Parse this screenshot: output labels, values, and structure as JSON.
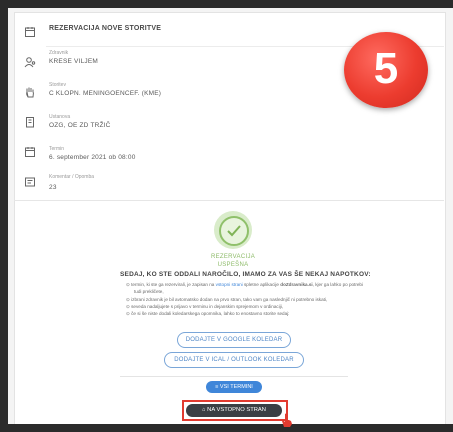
{
  "header": {
    "title": "REZERVACIJA NOVE STORITVE"
  },
  "fields": [
    {
      "label": "Zdravnik",
      "value": "KRESE VILJEM",
      "icon": "doctor-icon"
    },
    {
      "label": "Storitev",
      "value": "C KLOPN. MENINGOENCEF. (KME)",
      "icon": "service-hand-icon"
    },
    {
      "label": "Ustanova",
      "value": "OZG, OE ZD TRŽIČ",
      "icon": "building-icon"
    },
    {
      "label": "Termin",
      "value": "6. september 2021 ob 08:00",
      "icon": "calendar-icon"
    },
    {
      "label": "Komentar / Opomba",
      "value": "23",
      "icon": "comment-icon"
    }
  ],
  "step_badge": "5",
  "success": {
    "line1": "REZERVACIJA",
    "line2": "USPEŠNA"
  },
  "tips": {
    "title": "SEDAJ, KO STE ODDALI NAROČILO, IMAMO ZA VAS ŠE NEKAJ NAPOTKOV:",
    "t1a": "⊙ termin, ki ste ga rezervirali, je zapisan na ",
    "t1link": "vstopni strani",
    "t1b": " spletne aplikacije ",
    "t1bold": "doZdravnika.si",
    "t1c": ", kjer ga lahko po potrebi",
    "t1d": "tudi prekličete,",
    "t2": "⊙ izbrani zdravnik je bil avtomatsko dodan na prvo stran, tako vam ga naslednjič ni potrebno iskati,",
    "t3": "⊙ seveda nadaljujete s prijavo v terminu in dejanskim sprejemom v ordinaciji,",
    "t4": "⊙ če si še niste dodali koledarskega opomnika, lahko to enostavno storite sedaj:"
  },
  "buttons": {
    "google": "DODAJTE V GOOGLE KOLEDAR",
    "ical": "DODAJTE V ICAL / OUTLOOK KOLEDAR",
    "all": "≡ VSI TERMINI",
    "home": "⌂ NA VSTOPNO STRAN"
  },
  "colors": {
    "accent": "#3f86d9",
    "success": "#8dbb68",
    "badge": "#ec3c2f",
    "highlight": "#e23b30",
    "dark_button": "#3b3f44"
  }
}
